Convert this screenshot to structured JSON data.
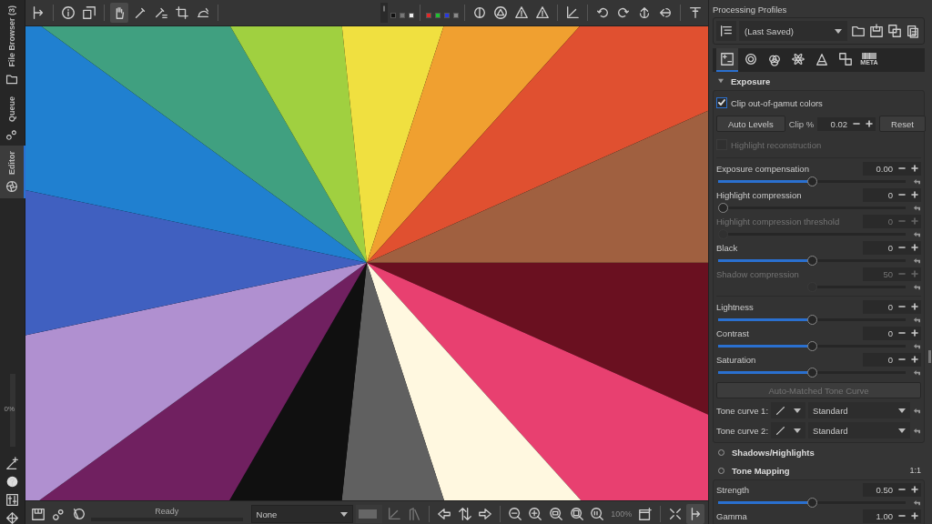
{
  "left_tabs": [
    {
      "label": "File Browser (3)",
      "selected": false
    },
    {
      "label": "Queue",
      "selected": false
    },
    {
      "label": "Editor",
      "selected": true
    }
  ],
  "left_progress": {
    "reading": "0%",
    "level": 0
  },
  "top_tools": [
    {
      "selected": true
    },
    {
      "selected": false
    },
    {
      "selected": false
    },
    {
      "selected": false
    },
    {
      "selected": false
    }
  ],
  "preview_backgrounds": [
    {
      "color": "#111111"
    },
    {
      "color": "#777777"
    },
    {
      "color": "#eeeeee"
    }
  ],
  "channels": [
    {
      "color": "#e02828"
    },
    {
      "color": "#20c030"
    },
    {
      "color": "#2838e0"
    },
    {
      "color": "#8a8a8a"
    }
  ],
  "status": {
    "text": "Ready",
    "level": 0
  },
  "bottom_bar": {
    "profile_select": "None",
    "zoom": "100%"
  },
  "panel": {
    "title": "Processing Profiles",
    "profile": "(Last Saved)",
    "tool_tabs": [
      {
        "selected": true
      },
      {
        "selected": false
      },
      {
        "selected": false
      },
      {
        "selected": false
      },
      {
        "selected": false
      },
      {
        "selected": false
      },
      {
        "selected": false,
        "label": "META"
      }
    ],
    "exposure": {
      "title": "Exposure",
      "expanded": true,
      "clip_gamut": {
        "label": "Clip out-of-gamut colors",
        "checked": true,
        "disabled": false
      },
      "auto_levels": "Auto Levels",
      "clip_label": "Clip %",
      "clip_value": "0.02",
      "reset": "Reset",
      "highlight_reconstruction": {
        "label": "Highlight reconstruction",
        "checked": false,
        "disabled": true
      },
      "sliders": [
        {
          "label": "Exposure compensation",
          "value": "0.00",
          "level": 0.5,
          "disabled": false
        },
        {
          "label": "Highlight compression",
          "value": "0",
          "level": 0,
          "disabled": false
        },
        {
          "label": "Highlight compression threshold",
          "value": "0",
          "level": 0,
          "disabled": true
        },
        {
          "label": "Black",
          "value": "0",
          "level": 0.5,
          "disabled": false
        },
        {
          "label": "Shadow compression",
          "value": "50",
          "level": 0.5,
          "disabled": true
        }
      ],
      "tone_sliders": [
        {
          "label": "Lightness",
          "value": "0",
          "level": 0.5,
          "disabled": false
        },
        {
          "label": "Contrast",
          "value": "0",
          "level": 0.5,
          "disabled": false
        },
        {
          "label": "Saturation",
          "value": "0",
          "level": 0.5,
          "disabled": false
        }
      ],
      "auto_tone_curve": {
        "label": "Auto-Matched Tone Curve",
        "disabled": true
      },
      "tone_curves": [
        {
          "label": "Tone curve 1:",
          "value": "Standard"
        },
        {
          "label": "Tone curve 2:",
          "value": "Standard"
        }
      ]
    },
    "shadows_highlights": {
      "title": "Shadows/Highlights",
      "enabled": false
    },
    "tone_mapping": {
      "title": "Tone Mapping",
      "enabled": false,
      "badge": "1:1",
      "sliders": [
        {
          "label": "Strength",
          "value": "0.50",
          "level": 0.5,
          "disabled": false
        },
        {
          "label": "Gamma",
          "value": "1.00",
          "disabled": false
        }
      ]
    }
  }
}
